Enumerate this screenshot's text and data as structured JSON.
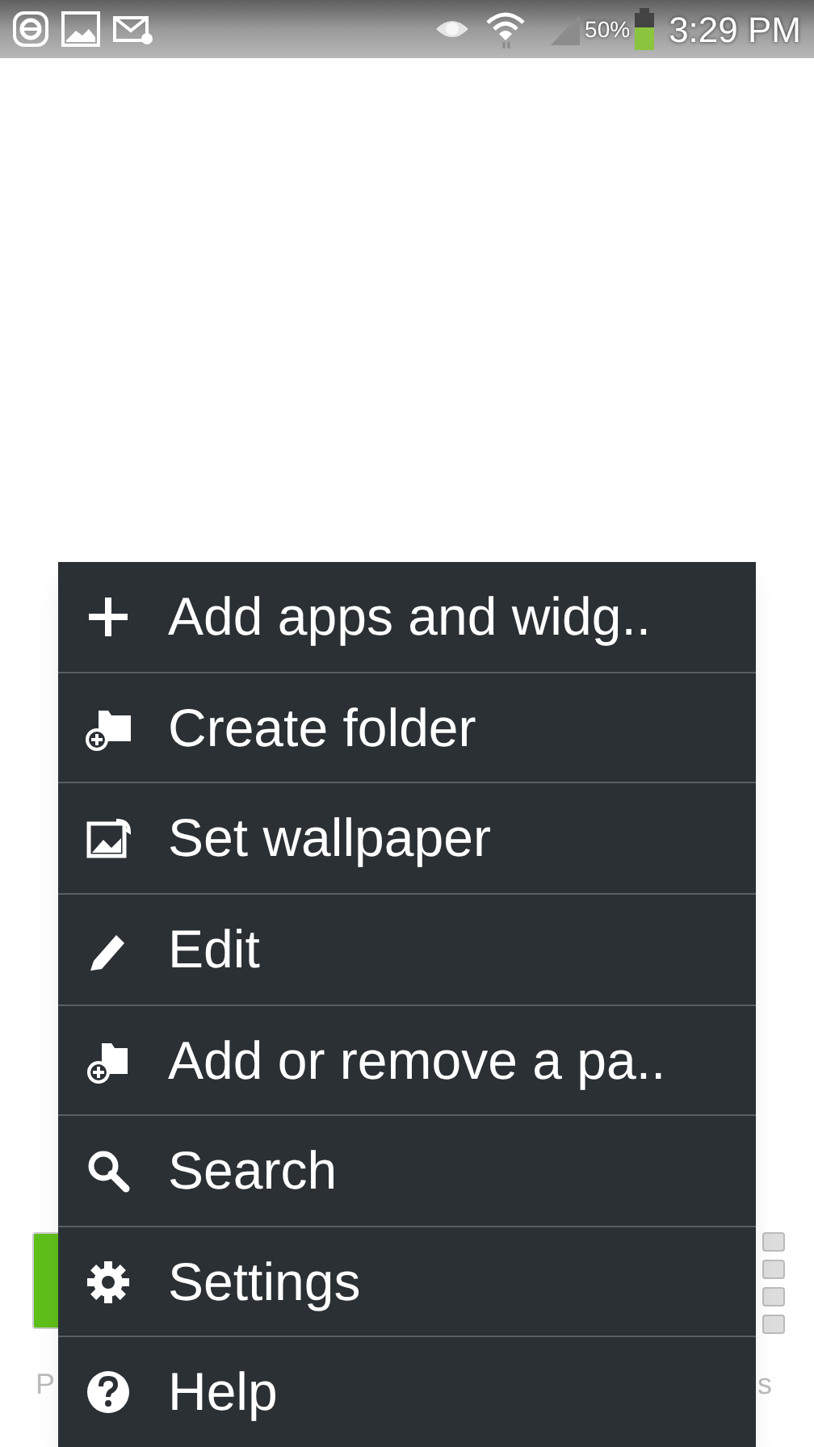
{
  "status_bar": {
    "battery": "50%",
    "time": "3:29 PM"
  },
  "home_screen": {
    "left_label": "P",
    "right_label": "s"
  },
  "menu": {
    "items": [
      {
        "kind": "add",
        "label": "Add apps and widg.."
      },
      {
        "kind": "folder",
        "label": "Create folder"
      },
      {
        "kind": "wallpaper",
        "label": "Set wallpaper"
      },
      {
        "kind": "edit",
        "label": "Edit"
      },
      {
        "kind": "page",
        "label": "Add or remove a pa.."
      },
      {
        "kind": "search",
        "label": "Search"
      },
      {
        "kind": "settings",
        "label": "Settings"
      },
      {
        "kind": "help",
        "label": "Help"
      }
    ]
  }
}
